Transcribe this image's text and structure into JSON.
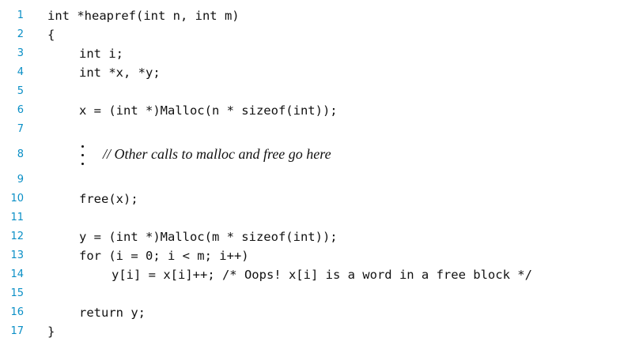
{
  "listing": {
    "lines": [
      {
        "num": "1",
        "code": "int *heapref(int n, int m)"
      },
      {
        "num": "2",
        "code": "{"
      },
      {
        "num": "3",
        "code": "int i;"
      },
      {
        "num": "4",
        "code": "int *x, *y;"
      },
      {
        "num": "5",
        "code": ""
      },
      {
        "num": "6",
        "code": "x = (int *)Malloc(n * sizeof(int));"
      },
      {
        "num": "7",
        "code": ""
      },
      {
        "num": "8",
        "code": "// Other calls to malloc and free go here"
      },
      {
        "num": "9",
        "code": ""
      },
      {
        "num": "10",
        "code": "free(x);"
      },
      {
        "num": "11",
        "code": ""
      },
      {
        "num": "12",
        "code": "y = (int *)Malloc(m * sizeof(int));"
      },
      {
        "num": "13",
        "code": "for (i = 0; i < m; i++)"
      },
      {
        "num": "14",
        "code": "y[i] = x[i]++; /* Oops! x[i] is a word in a free block */"
      },
      {
        "num": "15",
        "code": ""
      },
      {
        "num": "16",
        "code": "return y;"
      },
      {
        "num": "17",
        "code": "}"
      }
    ]
  }
}
